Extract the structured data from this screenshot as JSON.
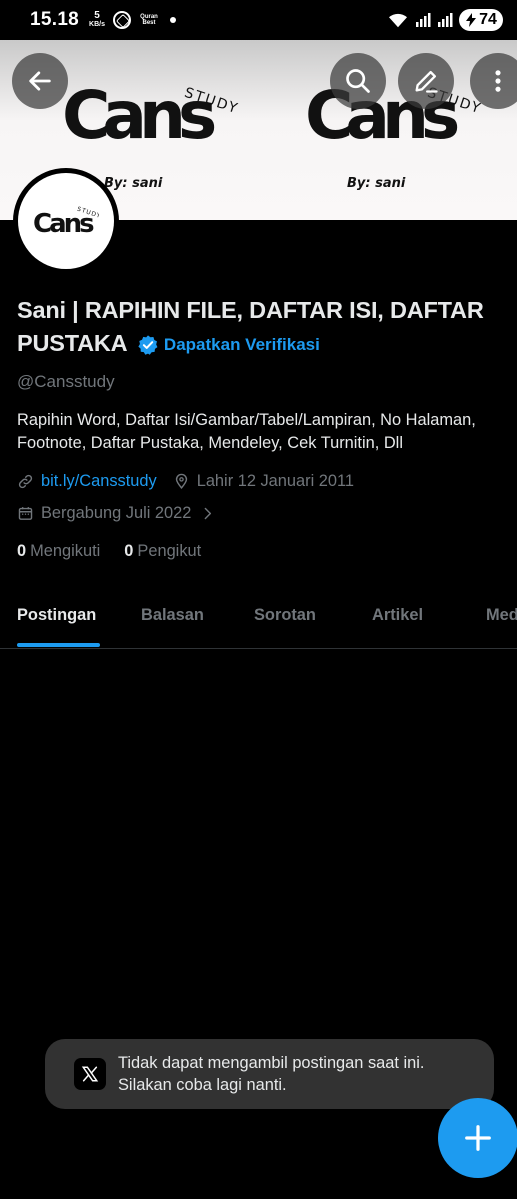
{
  "status_bar": {
    "time": "15.18",
    "speed_value": "5",
    "speed_unit": "KB/s",
    "quran_label": "Quran Best",
    "battery": "74"
  },
  "banner": {
    "logo_text": "Cans",
    "logo_sub": "STUDY",
    "by_line": "By: sani"
  },
  "profile": {
    "name": "Sani | RAPIHIN FILE, DAFTAR ISI, DAFTAR PUSTAKA",
    "verify_label": "Dapatkan Verifikasi",
    "handle": "@Cansstudy",
    "bio": "Rapihin Word, Daftar Isi/Gambar/Tabel/Lampiran, No Halaman, Footnote, Daftar Pustaka, Mendeley, Cek Turnitin, Dll",
    "link": "bit.ly/Cansstudy",
    "birthday": "Lahir 12 Januari 2011",
    "joined": "Bergabung Juli 2022",
    "following_count": "0",
    "following_label": "Mengikuti",
    "followers_count": "0",
    "followers_label": "Pengikut"
  },
  "tabs": [
    {
      "label": "Postingan",
      "active": true
    },
    {
      "label": "Balasan"
    },
    {
      "label": "Sorotan"
    },
    {
      "label": "Artikel"
    },
    {
      "label": "Media"
    }
  ],
  "toast": {
    "line1": "Tidak dapat mengambil postingan saat ini.",
    "line2": "Silakan coba lagi nanti."
  },
  "colors": {
    "accent": "#1d9bf0",
    "background": "#000000",
    "secondary_text": "#71767b",
    "toast_bg": "#323232"
  },
  "icons": [
    "back-arrow-icon",
    "search-icon",
    "edit-icon",
    "more-vertical-icon",
    "verified-badge-icon",
    "link-icon",
    "location-icon",
    "calendar-icon",
    "chevron-right-icon",
    "x-logo-icon",
    "plus-icon",
    "wifi-icon",
    "signal-icon"
  ]
}
